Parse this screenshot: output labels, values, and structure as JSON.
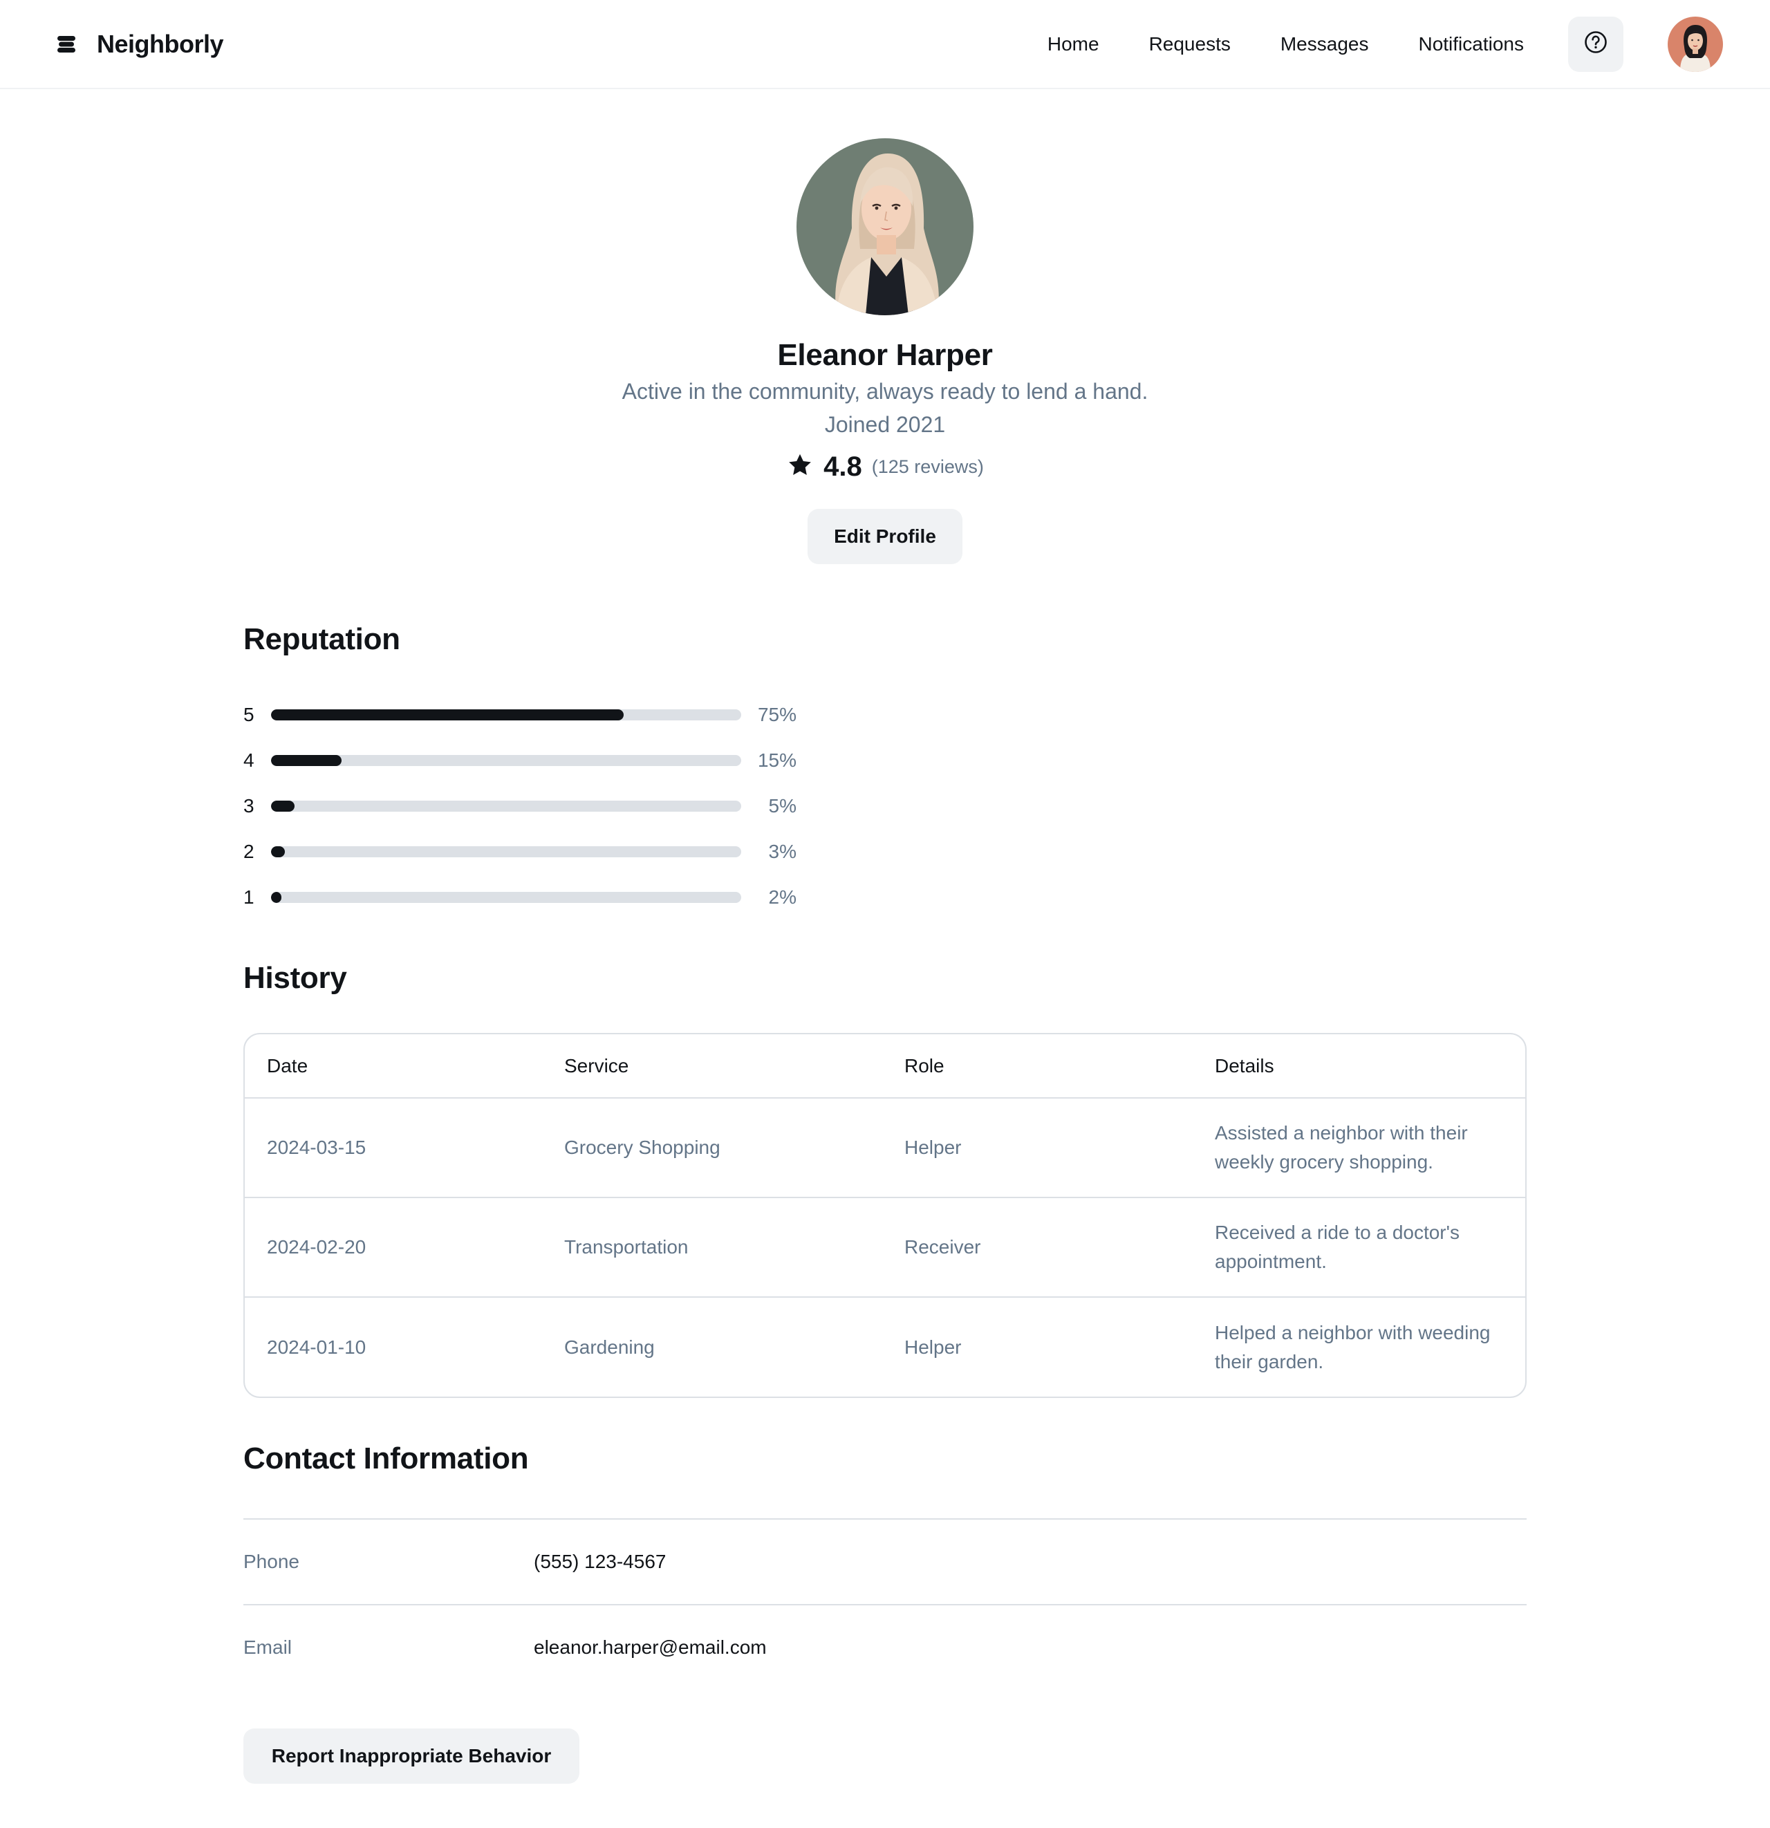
{
  "app": {
    "name": "Neighborly",
    "logo_icon": "stack-logo-icon"
  },
  "nav": {
    "links": [
      "Home",
      "Requests",
      "Messages",
      "Notifications"
    ],
    "help_icon": "question-circle-icon",
    "avatar_icon": "user-avatar"
  },
  "profile": {
    "name": "Eleanor Harper",
    "bio": "Active in the community, always ready to lend a hand.",
    "joined": "Joined 2021",
    "rating": "4.8",
    "reviews": "(125 reviews)",
    "star_icon": "star-icon",
    "edit_label": "Edit Profile"
  },
  "reputation": {
    "title": "Reputation",
    "rows": [
      {
        "stars": "5",
        "percent": 75,
        "label": "75%"
      },
      {
        "stars": "4",
        "percent": 15,
        "label": "15%"
      },
      {
        "stars": "3",
        "percent": 5,
        "label": "5%"
      },
      {
        "stars": "2",
        "percent": 3,
        "label": "3%"
      },
      {
        "stars": "1",
        "percent": 2,
        "label": "2%"
      }
    ]
  },
  "history": {
    "title": "History",
    "columns": [
      "Date",
      "Service",
      "Role",
      "Details"
    ],
    "rows": [
      [
        "2024-03-15",
        "Grocery Shopping",
        "Helper",
        "Assisted a neighbor with their weekly grocery shopping."
      ],
      [
        "2024-02-20",
        "Transportation",
        "Receiver",
        "Received a ride to a doctor's appointment."
      ],
      [
        "2024-01-10",
        "Gardening",
        "Helper",
        "Helped a neighbor with weeding their garden."
      ]
    ]
  },
  "contact": {
    "title": "Contact Information",
    "phone_label": "Phone",
    "phone": "(555) 123-4567",
    "email_label": "Email",
    "email": "eleanor.harper@email.com"
  },
  "report_label": "Report Inappropriate Behavior",
  "colors": {
    "text": "#111418",
    "muted": "#637588",
    "track": "#dce0e5",
    "button": "#f0f2f4"
  }
}
